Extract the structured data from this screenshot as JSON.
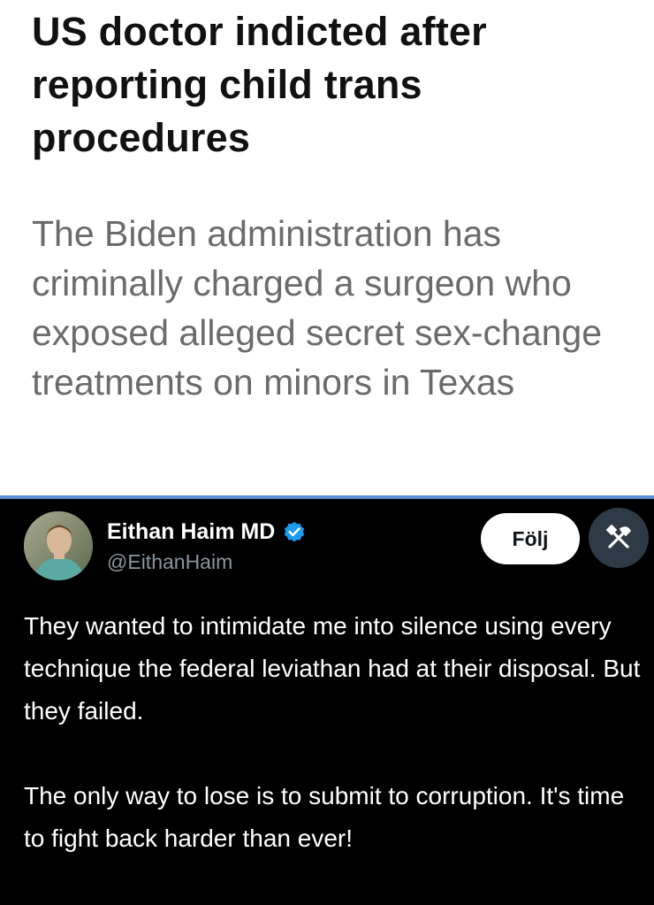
{
  "article": {
    "headline": "US doctor indicted after reporting child trans procedures",
    "subheadline": "The Biden administration has criminally charged a surgeon who exposed alleged secret sex-change treatments on minors in Texas"
  },
  "tweet": {
    "author": {
      "display_name": "Eithan Haim MD",
      "handle": "@EithanHaim",
      "verified": true,
      "avatar_icon": "profile-photo"
    },
    "follow_label": "Följ",
    "tools_icon": "tools-icon",
    "paragraphs": [
      "They wanted to intimidate me into silence using every technique the federal leviathan had at their disposal. But they failed.",
      "The only way to lose is to submit to corruption. It's time to fight back harder than ever!"
    ]
  },
  "colors": {
    "divider": "#5b8fd6",
    "verified_badge": "#1d9bf0",
    "tools_button_bg": "#2e3a45",
    "tweet_bg": "#000000"
  }
}
